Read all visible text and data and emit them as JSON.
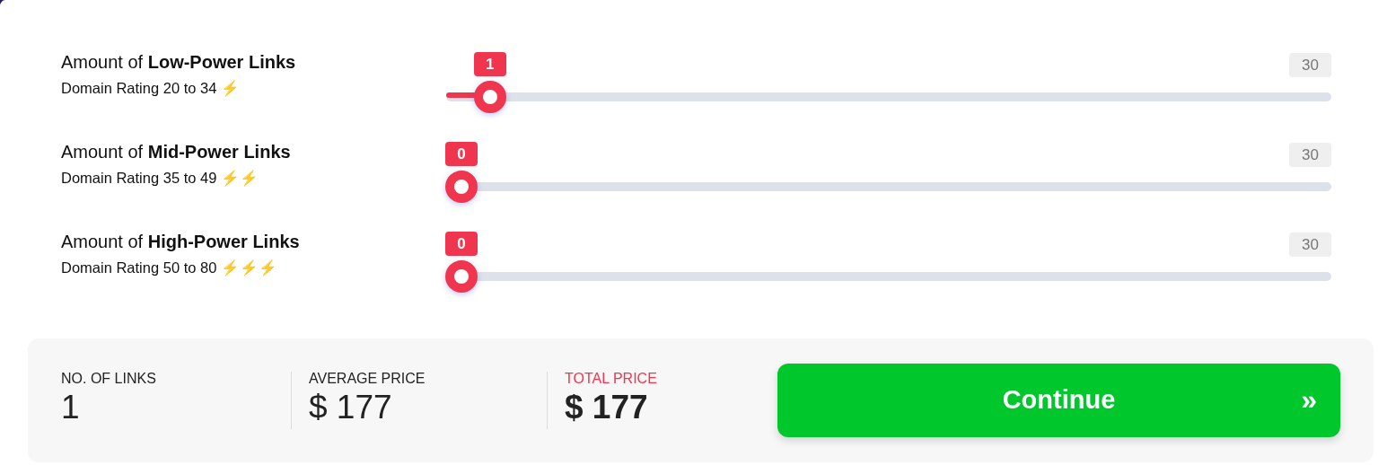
{
  "sliders": [
    {
      "label_prefix": "Amount of ",
      "label_strong": "Low-Power Links",
      "subtitle": "Domain Rating 20 to 34",
      "power": "⚡",
      "value": "1",
      "max": "30",
      "level": 0.0333
    },
    {
      "label_prefix": "Amount of ",
      "label_strong": "Mid-Power Links",
      "subtitle": "Domain Rating 35 to 49",
      "power": "⚡⚡",
      "value": "0",
      "max": "30",
      "level": 0
    },
    {
      "label_prefix": "Amount of ",
      "label_strong": "High-Power Links",
      "subtitle": "Domain Rating 50 to 80",
      "power": "⚡⚡⚡",
      "value": "0",
      "max": "30",
      "level": 0
    }
  ],
  "summary": {
    "stats": [
      {
        "label": "NO. OF LINKS",
        "value": "1",
        "kind": "plain"
      },
      {
        "label": "AVERAGE PRICE",
        "value": "$ 177",
        "kind": "plain"
      },
      {
        "label": "TOTAL PRICE",
        "value": "$ 177",
        "kind": "total"
      }
    ],
    "button": {
      "label": "Continue",
      "icon": "»"
    }
  }
}
